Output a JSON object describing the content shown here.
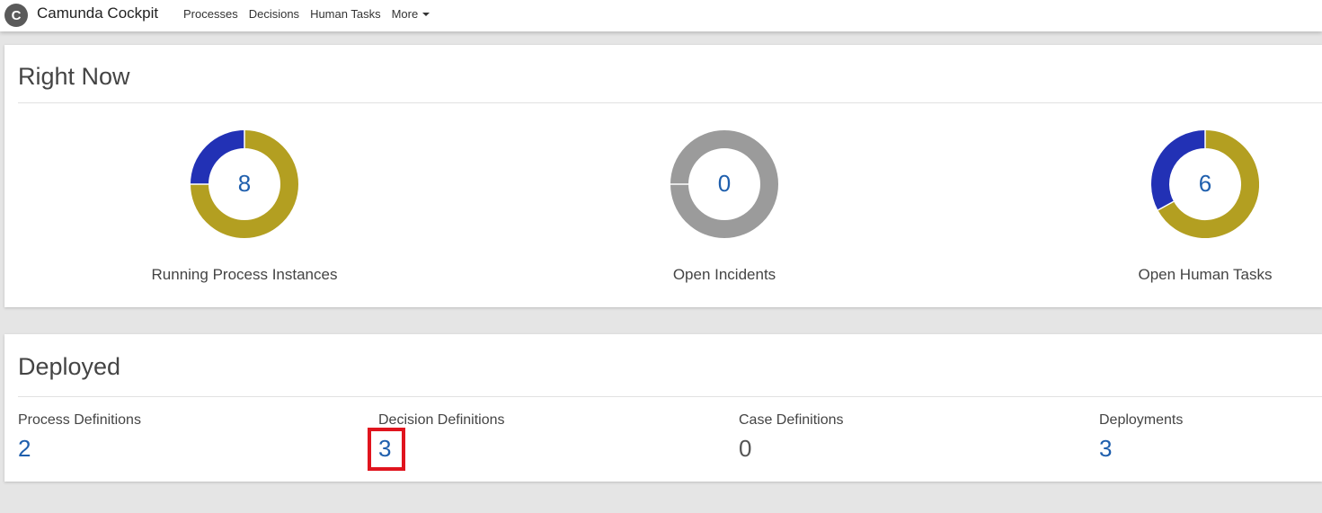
{
  "nav": {
    "brand": "Camunda Cockpit",
    "logo_letter": "C",
    "links": [
      "Processes",
      "Decisions",
      "Human Tasks"
    ],
    "more_label": "More"
  },
  "right_now": {
    "title": "Right Now",
    "widgets": [
      {
        "label": "Running Process Instances",
        "value": "8",
        "fraction_primary": 0.25
      },
      {
        "label": "Open Incidents",
        "value": "0",
        "fraction_primary": 0.0
      },
      {
        "label": "Open Human Tasks",
        "value": "6",
        "fraction_primary": 0.33
      }
    ]
  },
  "deployed": {
    "title": "Deployed",
    "stats": [
      {
        "label": "Process Definitions",
        "value": "2"
      },
      {
        "label": "Decision Definitions",
        "value": "3"
      },
      {
        "label": "Case Definitions",
        "value": "0"
      },
      {
        "label": "Deployments",
        "value": "3"
      }
    ]
  },
  "colors": {
    "link_blue": "#1f5fad",
    "donut_blue": "#2231b5",
    "donut_gold": "#b39f21",
    "donut_gray": "#9b9b9b",
    "highlight_red": "#e0141e"
  }
}
